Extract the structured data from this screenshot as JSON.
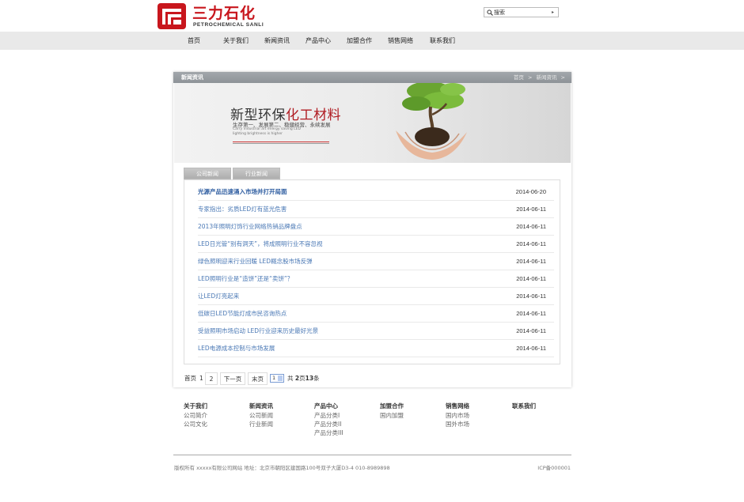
{
  "brand": {
    "name_cn": "三力石化",
    "name_en": "PETROCHEMICAL SANLI",
    "color": "#c8161d"
  },
  "search": {
    "placeholder": "搜索",
    "icon": "search-icon"
  },
  "nav": [
    {
      "label": "首页"
    },
    {
      "label": "关于我们"
    },
    {
      "label": "新闻资讯"
    },
    {
      "label": "产品中心"
    },
    {
      "label": "加盟合作"
    },
    {
      "label": "销售网络"
    },
    {
      "label": "联系我们"
    }
  ],
  "panel": {
    "title": "新闻资讯",
    "breadcrumb": [
      "首页",
      ">",
      "新闻资讯",
      ">"
    ]
  },
  "banner": {
    "title_main": "新型环保",
    "title_accent": "化工材料",
    "subtitle": "生存第一、发展第二、稳健经营、永续发展",
    "en_text": "Carry industrial art energy saving LED lighting brightness is higher"
  },
  "tabs": [
    {
      "label": "公司新闻"
    },
    {
      "label": "行业新闻"
    }
  ],
  "news": [
    {
      "title": "光源产品迅速涌入市场并打开局面",
      "date": "2014-06-20",
      "bold": true
    },
    {
      "title": "专家指出：劣质LED灯有蓝光危害",
      "date": "2014-06-11",
      "bold": false
    },
    {
      "title": "2013年照明灯饰行业网络热销品牌盘点",
      "date": "2014-06-11",
      "bold": false
    },
    {
      "title": "LED日光管“别有洞天”，将成照明行业不容忽视",
      "date": "2014-06-11",
      "bold": false
    },
    {
      "title": "绿色照明迎来行业回暖 LED概念股市场反弹",
      "date": "2014-06-11",
      "bold": false
    },
    {
      "title": "LED照明行业是“造饼”还是“卖饼”？",
      "date": "2014-06-11",
      "bold": false
    },
    {
      "title": "让LED灯亮起来",
      "date": "2014-06-11",
      "bold": false
    },
    {
      "title": "低碳日LED节能灯成市民咨询热点",
      "date": "2014-06-11",
      "bold": false
    },
    {
      "title": "受益照明市场启动 LED行业迎来历史最好光景",
      "date": "2014-06-11",
      "bold": false
    },
    {
      "title": "LED电源成本控制与市场发展",
      "date": "2014-06-11",
      "bold": false
    }
  ],
  "pager": {
    "first": "首页",
    "current": "1",
    "page2": "2",
    "next": "下一页",
    "last": "末页",
    "select_value": "1",
    "total_prefix": "共",
    "total_pages": "2",
    "pages_unit": "页",
    "total_items": "13",
    "items_unit": "条"
  },
  "footer": {
    "columns": [
      {
        "heading": "关于我们",
        "items": [
          "公司简介",
          "公司文化"
        ]
      },
      {
        "heading": "新闻资讯",
        "items": [
          "公司新闻",
          "行业新闻"
        ]
      },
      {
        "heading": "产品中心",
        "items": [
          "产品分类I",
          "产品分类II",
          "产品分类III"
        ]
      },
      {
        "heading": "加盟合作",
        "items": [
          "国内加盟"
        ]
      },
      {
        "heading": "销售网络",
        "items": [
          "国内市场",
          "国外市场"
        ]
      },
      {
        "heading": "联系我们",
        "items": []
      }
    ],
    "copyright": "版权所有 xxxxx有限公司网站 地址：北京市朝阳区建国路100号双子大厦D3-4 010-8989898",
    "icp": "ICP备000001"
  }
}
